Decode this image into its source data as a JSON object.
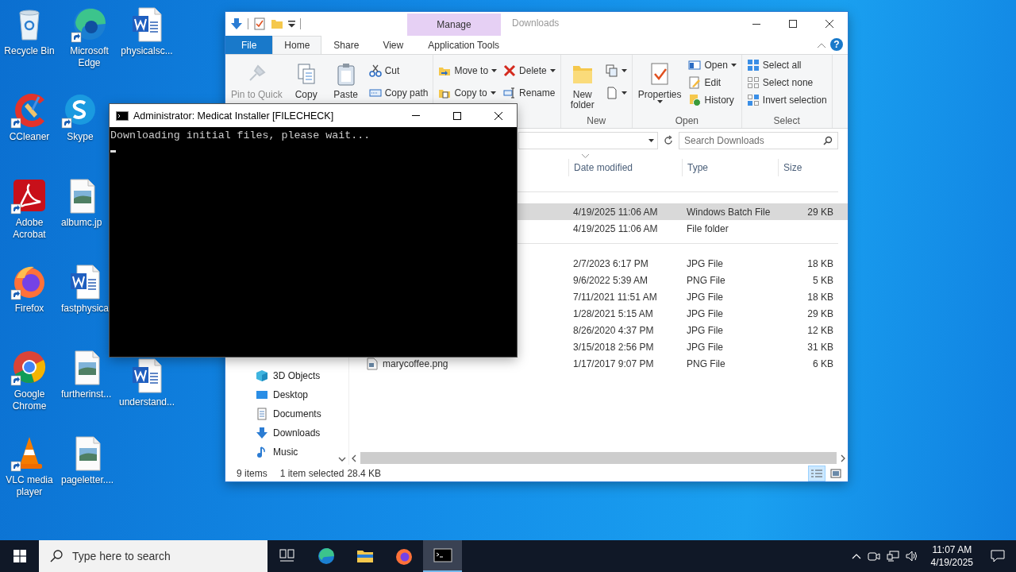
{
  "desktop_icons": [
    [
      {
        "label": "Recycle Bin",
        "kind": "recycle",
        "shortcut": false
      },
      {
        "label": "CCleaner",
        "kind": "ccleaner",
        "shortcut": true
      },
      {
        "label": "Adobe Acrobat",
        "kind": "pdf",
        "shortcut": true
      },
      {
        "label": "Firefox",
        "kind": "firefox",
        "shortcut": true
      },
      {
        "label": "Google Chrome",
        "kind": "chrome",
        "shortcut": true
      },
      {
        "label": "VLC media player",
        "kind": "vlc",
        "shortcut": true
      }
    ],
    [
      {
        "label": "Microsoft Edge",
        "kind": "edge",
        "shortcut": true
      },
      {
        "label": "Skype",
        "kind": "skype",
        "shortcut": true
      },
      {
        "label": "albumc.jp",
        "kind": "image",
        "shortcut": false
      },
      {
        "label": "fastphysica",
        "kind": "word",
        "shortcut": false
      },
      {
        "label": "furtherinst...",
        "kind": "image",
        "shortcut": false
      },
      {
        "label": "pageletter....",
        "kind": "image",
        "shortcut": false
      }
    ],
    [
      {
        "label": "physicalsc...",
        "kind": "word",
        "shortcut": false
      },
      {
        "label": "understand...",
        "kind": "word",
        "shortcut": false
      }
    ]
  ],
  "explorer": {
    "title": "Downloads",
    "contextual_group": "Manage",
    "tabs": [
      {
        "label": "File",
        "kind": "file",
        "selected": false
      },
      {
        "label": "Home",
        "kind": "tab",
        "selected": true
      },
      {
        "label": "Share",
        "kind": "tab",
        "selected": false
      },
      {
        "label": "View",
        "kind": "tab",
        "selected": false
      },
      {
        "label": "Application Tools",
        "kind": "contextual",
        "selected": false
      }
    ],
    "help": "?",
    "ribbon": [
      {
        "columns": [
          {
            "kind": "large",
            "buttons": [
              {
                "label": "Pin to Quick",
                "kind": "pin",
                "disabled": true
              }
            ]
          },
          {
            "kind": "large",
            "buttons": [
              {
                "label": "Copy",
                "kind": "copy",
                "disabled": false
              }
            ]
          },
          {
            "kind": "large",
            "buttons": [
              {
                "label": "Paste",
                "kind": "paste",
                "disabled": false
              }
            ]
          },
          {
            "kind": "small",
            "buttons": [
              {
                "label": "Cut",
                "kind": "cut",
                "disabled": false
              },
              {
                "label": "Copy path",
                "kind": "copypath",
                "disabled": false
              }
            ]
          }
        ]
      },
      {
        "columns": [
          {
            "kind": "small",
            "buttons": [
              {
                "label": "Move to",
                "kind": "moveto",
                "disabled": false,
                "dropdown": true
              },
              {
                "label": "Copy to",
                "kind": "copyto",
                "disabled": false,
                "dropdown": true
              }
            ]
          },
          {
            "kind": "small",
            "buttons": [
              {
                "label": "Delete",
                "kind": "delete",
                "disabled": false,
                "dropdown": true
              },
              {
                "label": "Rename",
                "kind": "rename",
                "disabled": false,
                "dropdown": false
              }
            ]
          }
        ]
      },
      {
        "label": "New",
        "columns": [
          {
            "kind": "large",
            "buttons": [
              {
                "label": "New\nfolder",
                "kind": "newfolder",
                "disabled": false
              }
            ]
          },
          {
            "kind": "small",
            "buttons": [
              {
                "kind": "newitem",
                "disabled": false,
                "dropdown": true
              },
              {
                "kind": "easyaccess",
                "disabled": false,
                "dropdown": true
              }
            ]
          }
        ]
      },
      {
        "label": "Open",
        "columns": [
          {
            "kind": "large",
            "buttons": [
              {
                "label": "Properties",
                "kind": "properties",
                "disabled": false,
                "dropdown": true
              }
            ]
          },
          {
            "kind": "small",
            "buttons": [
              {
                "label": "Open",
                "kind": "open",
                "disabled": false,
                "dropdown": true
              },
              {
                "label": "Edit",
                "kind": "edit",
                "disabled": false,
                "dropdown": false
              },
              {
                "label": "History",
                "kind": "history",
                "disabled": false,
                "dropdown": false
              }
            ]
          }
        ]
      },
      {
        "label": "Select",
        "columns": [
          {
            "kind": "small",
            "buttons": [
              {
                "label": "Select all",
                "kind": "selectall",
                "disabled": false
              },
              {
                "label": "Select none",
                "kind": "selectnone",
                "disabled": false
              },
              {
                "label": "Invert selection",
                "kind": "invert",
                "disabled": false
              }
            ]
          }
        ]
      }
    ],
    "search": {
      "placeholder": "Search Downloads"
    },
    "nav": [
      {
        "label": "3D Objects",
        "kind": "cube"
      },
      {
        "label": "Desktop",
        "kind": "desktop"
      },
      {
        "label": "Documents",
        "kind": "documents"
      },
      {
        "label": "Downloads",
        "kind": "downloads"
      },
      {
        "label": "Music",
        "kind": "music"
      }
    ],
    "columns": [
      "Date modified",
      "Type",
      "Size"
    ],
    "groups": [
      {
        "rows": [
          {
            "date": "4/19/2025 11:06 AM",
            "type": "Windows Batch File",
            "size": "29 KB",
            "selected": true
          },
          {
            "date": "4/19/2025 11:06 AM",
            "type": "File folder",
            "selected": false
          }
        ]
      },
      {
        "rows": [
          {
            "date": "2/7/2023 6:17 PM",
            "type": "JPG File",
            "size": "18 KB",
            "selected": false
          },
          {
            "date": "9/6/2022 5:39 AM",
            "type": "PNG File",
            "size": "5 KB",
            "selected": false
          },
          {
            "date": "7/11/2021 11:51 AM",
            "type": "JPG File",
            "size": "18 KB",
            "selected": false
          },
          {
            "date": "1/28/2021 5:15 AM",
            "type": "JPG File",
            "size": "29 KB",
            "selected": false
          },
          {
            "date": "8/26/2020 4:37 PM",
            "type": "JPG File",
            "size": "12 KB",
            "selected": false
          },
          {
            "date": "3/15/2018 2:56 PM",
            "type": "JPG File",
            "size": "31 KB",
            "selected": false
          },
          {
            "name": "marycoffee.png",
            "date": "1/17/2017 9:07 PM",
            "type": "PNG File",
            "size": "6 KB",
            "selected": false
          }
        ]
      }
    ],
    "status": {
      "count": "9 items",
      "selection": "1 item selected",
      "size": "28.4 KB"
    },
    "views": [
      {
        "kind": "details",
        "selected": true
      },
      {
        "kind": "large",
        "selected": false
      }
    ]
  },
  "console": {
    "title": "Administrator:  Medicat Installer [FILECHECK]",
    "lines": [
      "Downloading initial files, please wait..."
    ]
  },
  "taskbar": {
    "search_placeholder": "Type here to search",
    "apps": [
      {
        "kind": "taskview",
        "active": false
      },
      {
        "kind": "edge",
        "active": false
      },
      {
        "kind": "folder",
        "active": false
      },
      {
        "kind": "firefox",
        "active": false
      },
      {
        "kind": "console",
        "active": true
      }
    ],
    "time": "11:07 AM",
    "date": "4/19/2025"
  }
}
